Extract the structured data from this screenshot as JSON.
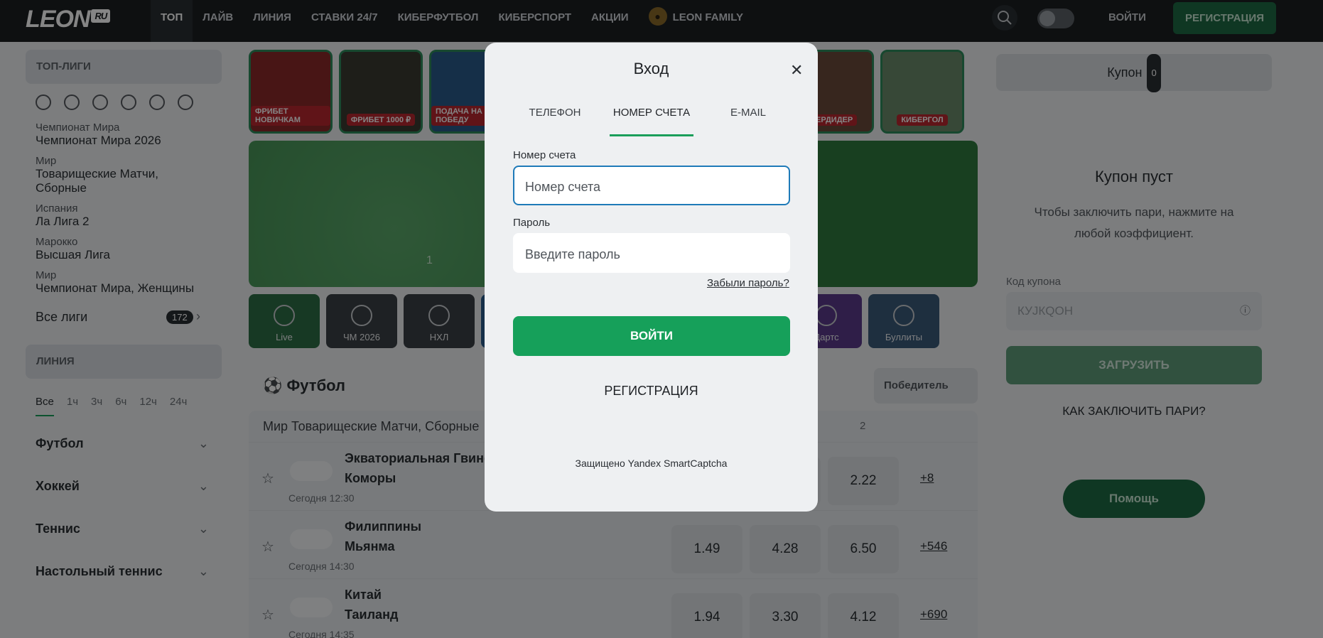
{
  "header": {
    "logo": "LEON",
    "logo_suffix": "RU",
    "nav": [
      "ТОП",
      "ЛАЙВ",
      "ЛИНИЯ",
      "СТАВКИ 24/7",
      "КИБЕРФУТБОЛ",
      "КИБЕРСПОРТ",
      "АКЦИИ",
      "LEON FAMILY"
    ],
    "login": "ВОЙТИ",
    "register": "РЕГИСТРАЦИЯ"
  },
  "sidebar": {
    "top_leagues_title": "ТОП-ЛИГИ",
    "leagues": [
      {
        "category": "Чемпионат Мира",
        "name": "Чемпионат Мира 2026"
      },
      {
        "category": "Мир",
        "name": "Товарищеские Матчи, Сборные"
      },
      {
        "category": "Испания",
        "name": "Ла Лига 2"
      },
      {
        "category": "Марокко",
        "name": "Высшая Лига"
      },
      {
        "category": "Мир",
        "name": "Чемпионат Мира, Женщины"
      }
    ],
    "all_leagues": "Все лиги",
    "all_leagues_count": "172",
    "line_title": "ЛИНИЯ",
    "time_tabs": [
      "Все",
      "1ч",
      "3ч",
      "6ч",
      "12ч",
      "24ч"
    ],
    "sports": [
      "Футбол",
      "Хоккей",
      "Теннис",
      "Настольный теннис"
    ]
  },
  "promos": [
    "ФРИБЕТ НОВИЧКАМ",
    "ФРИБЕТ 1000 ₽",
    "ПОДАЧА НА ПОБЕДУ",
    "ГЕРДИДЕР",
    "КИБЕРГОЛ"
  ],
  "banner": {
    "slide": "1"
  },
  "tiles": [
    "Live",
    "ЧМ 2026",
    "НХЛ",
    "Дартс",
    "Буллиты"
  ],
  "football": {
    "title": "Футбол",
    "market": "Победитель",
    "league": "Мир Товарищеские Матчи, Сборные",
    "col_two": "2",
    "matches": [
      {
        "team1": "Экваториальная Гвинея",
        "team2": "Коморы",
        "time": "Сегодня 12:30",
        "odds": [
          "",
          "",
          "2.22"
        ],
        "more": "+8"
      },
      {
        "team1": "Филиппины",
        "team2": "Мьянма",
        "time": "Сегодня 14:30",
        "odds": [
          "1.49",
          "4.28",
          "6.50"
        ],
        "more": "+546"
      },
      {
        "team1": "Китай",
        "team2": "Таиланд",
        "time": "Сегодня 14:35",
        "odds": [
          "1.94",
          "3.30",
          "4.12"
        ],
        "more": "+690"
      }
    ]
  },
  "coupon": {
    "title": "Купон",
    "count": "0",
    "empty_title": "Купон пуст",
    "empty_hint": "Чтобы заключить пари, нажмите на любой коэффициент.",
    "code_label": "Код купона",
    "code_placeholder": "КУJКQОН",
    "load": "ЗАГРУЗИТЬ",
    "how_to": "КАК ЗАКЛЮЧИТЬ ПАРИ?",
    "help": "Помощь"
  },
  "login_modal": {
    "title": "Вход",
    "tabs": [
      "ТЕЛЕФОН",
      "НОМЕР СЧЕТА",
      "E-MAIL"
    ],
    "account_label": "Номер счета",
    "account_placeholder": "Номер счета",
    "password_label": "Пароль",
    "password_placeholder": "Введите пароль",
    "forgot": "Забыли пароль?",
    "submit": "ВОЙТИ",
    "register": "РЕГИСТРАЦИЯ",
    "captcha": "Защищено Yandex SmartCaptcha"
  }
}
